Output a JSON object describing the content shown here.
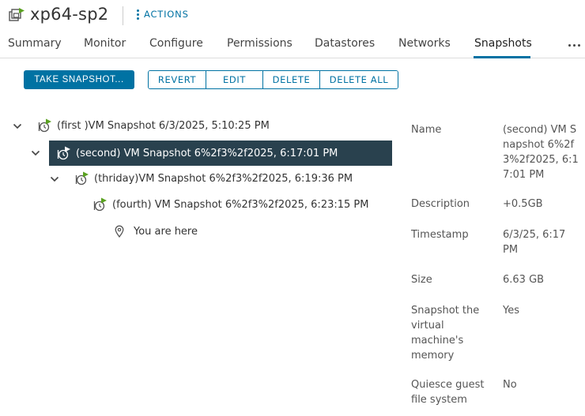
{
  "header": {
    "vm_name": "xp64-sp2",
    "actions_label": "ACTIONS"
  },
  "tabs": [
    {
      "label": "Summary",
      "active": false
    },
    {
      "label": "Monitor",
      "active": false
    },
    {
      "label": "Configure",
      "active": false
    },
    {
      "label": "Permissions",
      "active": false
    },
    {
      "label": "Datastores",
      "active": false
    },
    {
      "label": "Networks",
      "active": false
    },
    {
      "label": "Snapshots",
      "active": true
    }
  ],
  "toolbar": {
    "take_snapshot": "TAKE SNAPSHOT...",
    "revert": "REVERT",
    "edit": "EDIT",
    "delete": "DELETE",
    "delete_all": "DELETE ALL"
  },
  "tree": {
    "items": [
      {
        "label": "(first )VM Snapshot 6/3/2025, 5:10:25 PM",
        "expanded": true,
        "selected": false
      },
      {
        "label": "(second) VM Snapshot 6%2f3%2f2025, 6:17:01 PM",
        "expanded": true,
        "selected": true
      },
      {
        "label": "(thriday)VM Snapshot 6%2f3%2f2025, 6:19:36 PM",
        "expanded": true,
        "selected": false
      },
      {
        "label": "(fourth) VM Snapshot 6%2f3%2f2025, 6:23:15 PM",
        "expanded": false,
        "selected": false
      }
    ],
    "current": "You are here"
  },
  "details": {
    "name_label": "Name",
    "name_value": "(second) VM Snapshot 6%2f3%2f2025, 6:17:01 PM",
    "description_label": "Description",
    "description_value": "+0.5GB",
    "timestamp_label": "Timestamp",
    "timestamp_value": "6/3/25, 6:17 PM",
    "size_label": "Size",
    "size_value": "6.63 GB",
    "memory_label": "Snapshot the virtual machine's memory",
    "memory_value": "Yes",
    "quiesce_label": "Quiesce guest file system",
    "quiesce_value": "No"
  },
  "colors": {
    "accent": "#0072a3",
    "selected_row": "#29414e",
    "snapshot_green": "#5aa220"
  }
}
